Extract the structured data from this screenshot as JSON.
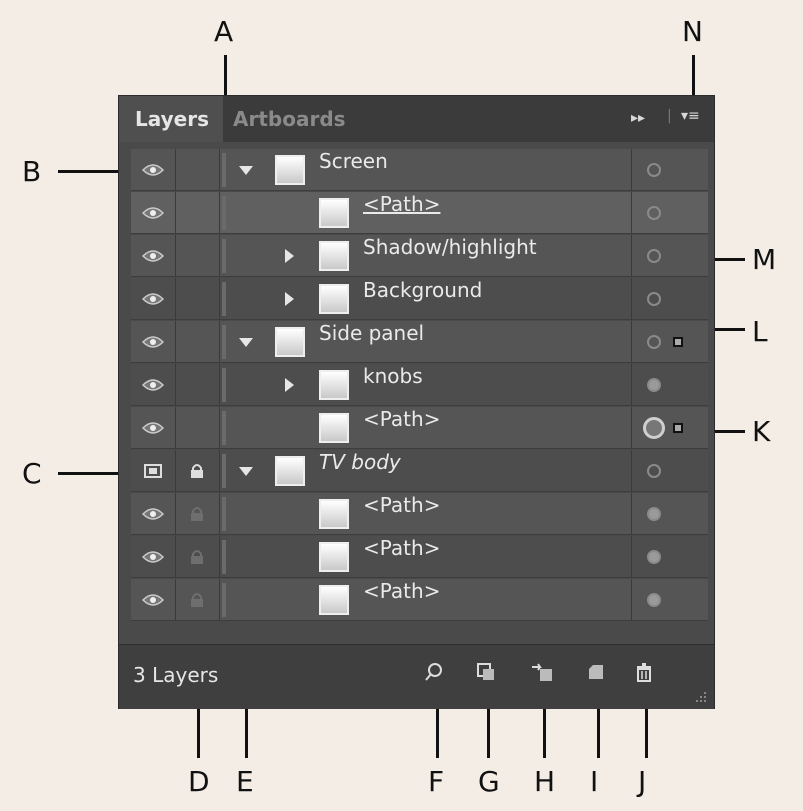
{
  "panel": {
    "tabs": [
      {
        "label": "Layers",
        "active": true
      },
      {
        "label": "Artboards",
        "active": false
      }
    ],
    "layer_count_label": "3 Layers"
  },
  "rows": [
    {
      "name": "Screen",
      "toggle": "expanded",
      "visible": true,
      "locked": false,
      "target": "empty",
      "style": "normal"
    },
    {
      "name": "<Path>",
      "toggle": "none",
      "visible": true,
      "locked": false,
      "target": "empty",
      "style": "underline"
    },
    {
      "name": "Shadow/highlight",
      "toggle": "collapsed",
      "visible": true,
      "locked": false,
      "target": "empty",
      "style": "normal"
    },
    {
      "name": "Background",
      "toggle": "collapsed",
      "visible": true,
      "locked": false,
      "target": "empty",
      "style": "normal"
    },
    {
      "name": "Side panel",
      "toggle": "expanded",
      "visible": true,
      "locked": false,
      "target": "empty",
      "style": "normal",
      "selected_art": true
    },
    {
      "name": "knobs",
      "toggle": "collapsed",
      "visible": true,
      "locked": false,
      "target": "filled",
      "style": "normal"
    },
    {
      "name": "<Path>",
      "toggle": "none",
      "visible": true,
      "locked": false,
      "target": "targeted",
      "style": "normal",
      "selected_art": true
    },
    {
      "name": "TV body",
      "toggle": "expanded",
      "visible": "template",
      "locked": true,
      "target": "empty",
      "style": "italic"
    },
    {
      "name": "<Path>",
      "toggle": "none",
      "visible": true,
      "locked": "inherited",
      "target": "filled",
      "style": "normal"
    },
    {
      "name": "<Path>",
      "toggle": "none",
      "visible": true,
      "locked": "inherited",
      "target": "filled",
      "style": "normal"
    },
    {
      "name": "<Path>",
      "toggle": "none",
      "visible": true,
      "locked": "inherited",
      "target": "filled",
      "style": "normal"
    }
  ],
  "callouts": {
    "A": "A",
    "B": "B",
    "C": "C",
    "D": "D",
    "E": "E",
    "F": "F",
    "G": "G",
    "H": "H",
    "I": "I",
    "J": "J",
    "K": "K",
    "L": "L",
    "M": "M",
    "N": "N"
  },
  "icons": {
    "visibility": "eye-icon",
    "template": "template-icon",
    "lock": "lock-icon",
    "locate": "magnifier-icon",
    "clipping_mask": "clipping-mask-icon",
    "new_sublayer": "new-sublayer-icon",
    "new_layer": "new-layer-icon",
    "delete": "trash-icon",
    "panel_menu": "panel-menu-icon"
  }
}
